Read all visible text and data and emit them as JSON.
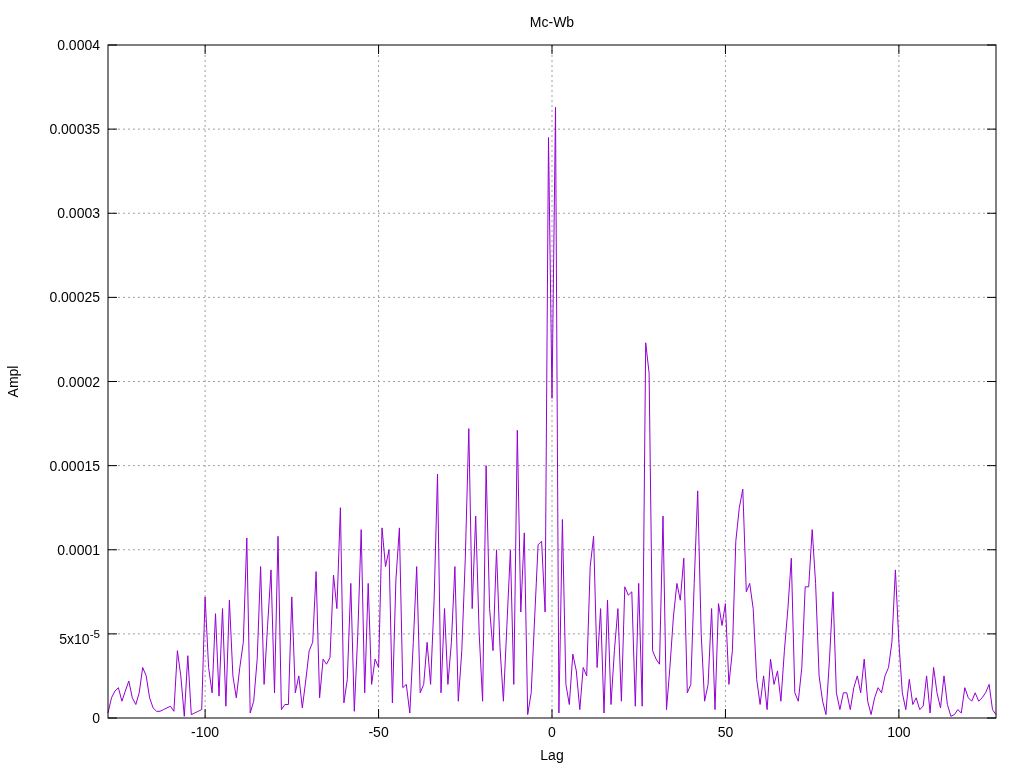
{
  "chart_data": {
    "type": "line",
    "title": "Mc-Wb",
    "xlabel": "Lag",
    "ylabel": "Ampl",
    "xlim": [
      -128,
      128
    ],
    "ylim": [
      0,
      0.0004
    ],
    "xticks": [
      -100,
      -50,
      0,
      50,
      100
    ],
    "yticks": [
      0,
      {
        "value": 5e-05,
        "label": "5x10$^{-5}$"
      },
      0.0001,
      0.00015,
      0.0002,
      0.00025,
      0.0003,
      0.00035,
      0.0004
    ],
    "grid": true,
    "x": [
      -128,
      -127,
      -126,
      -125,
      -124,
      -123,
      -122,
      -121,
      -120,
      -119,
      -118,
      -117,
      -116,
      -115,
      -114,
      -113,
      -112,
      -111,
      -110,
      -109,
      -108,
      -107,
      -106,
      -105,
      -104,
      -103,
      -102,
      -101,
      -100,
      -99,
      -98,
      -97,
      -96,
      -95,
      -94,
      -93,
      -92,
      -91,
      -90,
      -89,
      -88,
      -87,
      -86,
      -85,
      -84,
      -83,
      -82,
      -81,
      -80,
      -79,
      -78,
      -77,
      -76,
      -75,
      -74,
      -73,
      -72,
      -71,
      -70,
      -69,
      -68,
      -67,
      -66,
      -65,
      -64,
      -63,
      -62,
      -61,
      -60,
      -59,
      -58,
      -57,
      -56,
      -55,
      -54,
      -53,
      -52,
      -51,
      -50,
      -49,
      -48,
      -47,
      -46,
      -45,
      -44,
      -43,
      -42,
      -41,
      -40,
      -39,
      -38,
      -37,
      -36,
      -35,
      -34,
      -33,
      -32,
      -31,
      -30,
      -29,
      -28,
      -27,
      -26,
      -25,
      -24,
      -23,
      -22,
      -21,
      -20,
      -19,
      -18,
      -17,
      -16,
      -15,
      -14,
      -13,
      -12,
      -11,
      -10,
      -9,
      -8,
      -7,
      -6,
      -5,
      -4,
      -3,
      -2,
      -1,
      0,
      1,
      2,
      3,
      4,
      5,
      6,
      7,
      8,
      9,
      10,
      11,
      12,
      13,
      14,
      15,
      16,
      17,
      18,
      19,
      20,
      21,
      22,
      23,
      24,
      25,
      26,
      27,
      28,
      29,
      30,
      31,
      32,
      33,
      34,
      35,
      36,
      37,
      38,
      39,
      40,
      41,
      42,
      43,
      44,
      45,
      46,
      47,
      48,
      49,
      50,
      51,
      52,
      53,
      54,
      55,
      56,
      57,
      58,
      59,
      60,
      61,
      62,
      63,
      64,
      65,
      66,
      67,
      68,
      69,
      70,
      71,
      72,
      73,
      74,
      75,
      76,
      77,
      78,
      79,
      80,
      81,
      82,
      83,
      84,
      85,
      86,
      87,
      88,
      89,
      90,
      91,
      92,
      93,
      94,
      95,
      96,
      97,
      98,
      99,
      100,
      101,
      102,
      103,
      104,
      105,
      106,
      107,
      108,
      109,
      110,
      111,
      112,
      113,
      114,
      115,
      116,
      117,
      118,
      119,
      120,
      121,
      122,
      123,
      124,
      125,
      126,
      127,
      128
    ],
    "series": [
      {
        "color": "#9400d3",
        "values": [
          3e-06,
          1.2e-05,
          1.6e-05,
          1.8e-05,
          1e-05,
          1.6e-05,
          2.2e-05,
          1.2e-05,
          8e-06,
          1.5e-05,
          3e-05,
          2.5e-05,
          1.2e-05,
          6e-06,
          4e-06,
          4e-06,
          5e-06,
          6e-06,
          7e-06,
          4e-06,
          4e-05,
          2.5e-05,
          1e-06,
          3.7e-05,
          2e-06,
          3e-06,
          4e-06,
          5e-06,
          7.2e-05,
          3e-05,
          1.5e-05,
          6.2e-05,
          1.3e-05,
          6.5e-05,
          7e-06,
          7e-05,
          2.5e-05,
          1.2e-05,
          3e-05,
          4.5e-05,
          0.000107,
          3e-06,
          1e-05,
          3.5e-05,
          9e-05,
          2e-05,
          5.5e-05,
          8.8e-05,
          1.5e-05,
          0.000108,
          5e-06,
          8e-06,
          8e-06,
          7.2e-05,
          1.5e-05,
          2.5e-05,
          6e-06,
          2.2e-05,
          4e-05,
          4.5e-05,
          8.7e-05,
          1.2e-05,
          3.5e-05,
          3.2e-05,
          3.6e-05,
          8.5e-05,
          6.5e-05,
          0.000125,
          9e-06,
          2.3e-05,
          8e-05,
          4e-06,
          5e-05,
          0.000112,
          1.5e-05,
          8e-05,
          2e-05,
          3.5e-05,
          3e-05,
          0.000113,
          9e-05,
          0.0001,
          9e-06,
          8.2e-05,
          0.000113,
          1.8e-05,
          2e-05,
          3e-06,
          4.5e-05,
          9e-05,
          1.5e-05,
          2e-05,
          4.5e-05,
          2e-05,
          7e-05,
          0.000145,
          1.5e-05,
          6.5e-05,
          2e-05,
          4.5e-05,
          9e-05,
          1e-05,
          4e-05,
          9.5e-05,
          0.000172,
          6.5e-05,
          0.00012,
          5e-05,
          1e-05,
          0.00015,
          6.5e-05,
          4e-05,
          0.0001,
          4.2e-05,
          1e-05,
          5.5e-05,
          0.0001,
          2e-05,
          0.000171,
          6.3e-05,
          0.00011,
          2e-06,
          1.5e-05,
          6e-05,
          0.000103,
          0.000105,
          6.3e-05,
          0.000345,
          0.00019,
          0.000363,
          3e-06,
          0.000118,
          2e-05,
          8e-06,
          3.8e-05,
          2.8e-05,
          5e-06,
          3e-05,
          2.5e-05,
          9e-05,
          0.000108,
          3e-05,
          6.5e-05,
          3e-06,
          7e-05,
          8e-06,
          4e-05,
          6.5e-05,
          1e-05,
          7.8e-05,
          7.3e-05,
          7.5e-05,
          7e-06,
          8e-05,
          7e-06,
          0.000223,
          0.000205,
          4e-05,
          3.5e-05,
          3.2e-05,
          0.00012,
          5e-06,
          3e-05,
          6e-05,
          8e-05,
          7e-05,
          9.5e-05,
          1.5e-05,
          2e-05,
          8e-05,
          0.000135,
          5e-05,
          1e-05,
          2e-05,
          6.5e-05,
          5e-06,
          6.8e-05,
          5.5e-05,
          6.8e-05,
          2e-05,
          4e-05,
          0.000105,
          0.000125,
          0.000136,
          7.5e-05,
          8e-05,
          6.5e-05,
          2.3e-05,
          8e-06,
          2.5e-05,
          5e-06,
          3.5e-05,
          2e-05,
          2.8e-05,
          1e-05,
          4e-05,
          6.5e-05,
          9.5e-05,
          1.5e-05,
          1e-05,
          3e-05,
          7.8e-05,
          7.8e-05,
          0.000112,
          8e-05,
          2.5e-05,
          1e-05,
          2e-06,
          3.5e-05,
          7.5e-05,
          1.5e-05,
          5e-06,
          1.5e-05,
          1.5e-05,
          5e-06,
          1.8e-05,
          2.5e-05,
          1.5e-05,
          3.5e-05,
          1e-05,
          2e-06,
          1.2e-05,
          1.8e-05,
          1.5e-05,
          2.5e-05,
          3e-05,
          4.5e-05,
          8.8e-05,
          4.5e-05,
          1.5e-05,
          5e-06,
          2.3e-05,
          8e-06,
          1.2e-05,
          5e-06,
          7e-06,
          2.5e-05,
          3e-06,
          3e-05,
          1.5e-05,
          6e-06,
          2.5e-05,
          8e-06,
          1e-06,
          2e-06,
          5e-06,
          3e-06,
          1.8e-05,
          1.2e-05,
          1e-05,
          1.5e-05,
          1e-05,
          1.2e-05,
          1.5e-05,
          2e-05,
          5e-06,
          2e-06
        ]
      }
    ]
  }
}
